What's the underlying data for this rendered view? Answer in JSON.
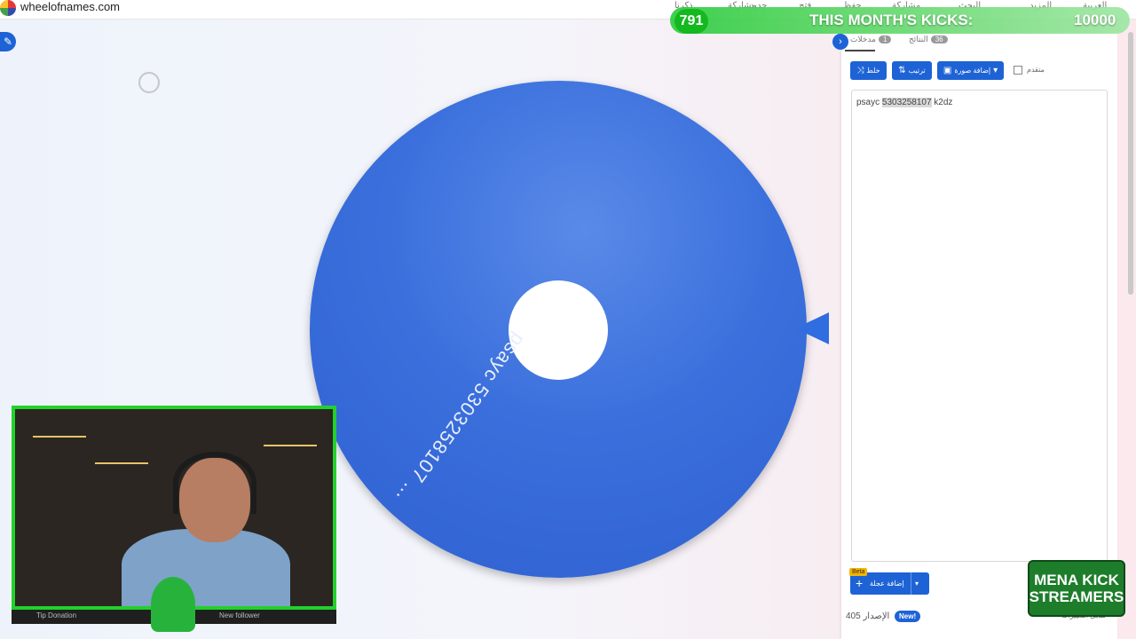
{
  "browser": {
    "site_title": "wheelofnames.com",
    "nav_items": [
      "ذكرنا",
      "مشاركة",
      "جديد",
      "فتح",
      "حفظ",
      "مشاركة",
      "البحث",
      "المزيد",
      "العربية"
    ]
  },
  "overlay": {
    "kick_count": "791",
    "label": "THIS MONTH'S KICKS:",
    "goal": "10000",
    "cam_bar_left": "Tip Donation",
    "cam_bar_right": "New follower",
    "logo_line1": "MENA KICK",
    "logo_line2": "STREAMERS"
  },
  "wheel": {
    "segment_label": "psayc 5303258107 ...",
    "color": "#3a6fdc"
  },
  "panel": {
    "tabs": [
      {
        "label": "مدخلات",
        "count": "1"
      },
      {
        "label": "النتائج",
        "count": "36"
      }
    ],
    "buttons": {
      "shuffle": "خلط",
      "sort": "ترتيب",
      "add_image": "إضافة صورة",
      "advanced": "متقدم"
    },
    "entry": {
      "prefix": "psayc ",
      "highlight": "5303258107",
      "suffix": " k2dz"
    },
    "add_image_beta": "إضافة عجلة",
    "beta_badge": "Beta",
    "version": "405 الإصدار",
    "new_badge": "New!",
    "changelog": "سجل التغييرات"
  },
  "colors": {
    "accent": "#1e63d6",
    "overlay_green": "#22d12b"
  }
}
